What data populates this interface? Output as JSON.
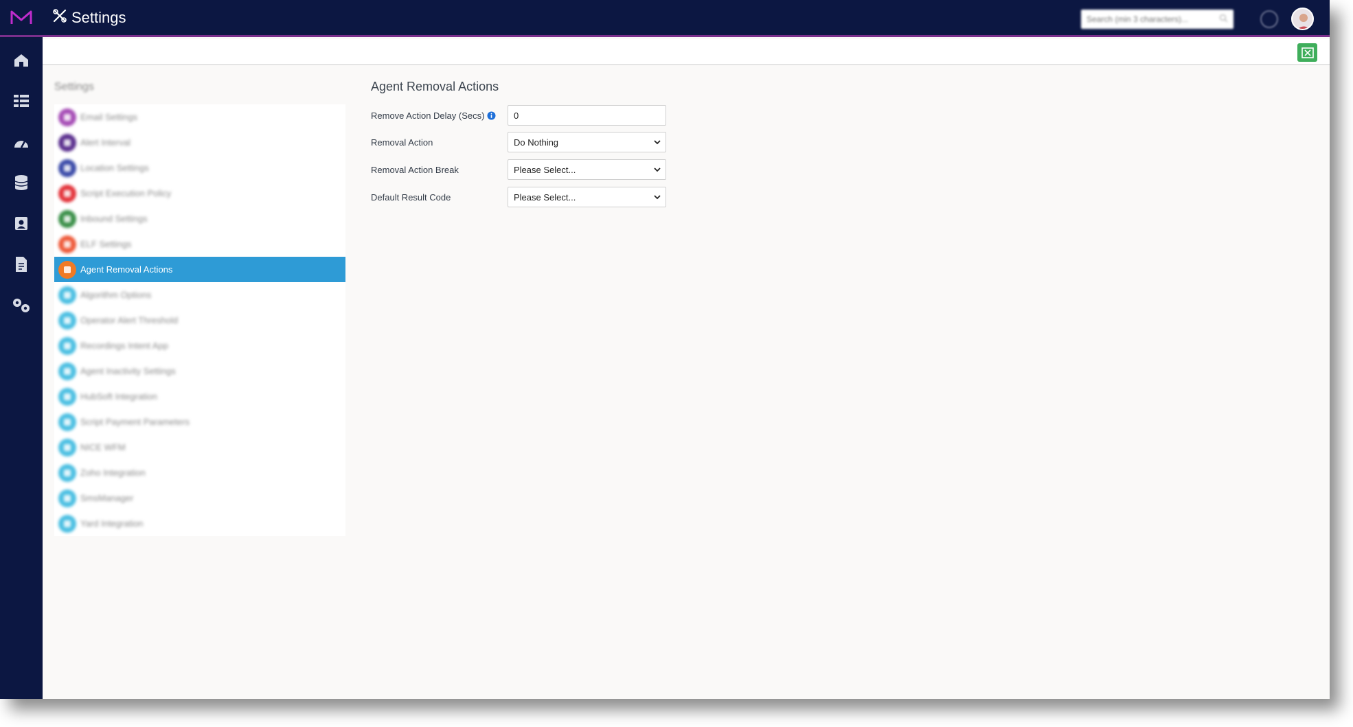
{
  "app": {
    "title": "Settings",
    "search_placeholder": "Search (min 3 characters)..."
  },
  "colors": {
    "topbar": "#0c1742",
    "accent": "#7b2f8c",
    "active_nav": "#2e9bd6",
    "export_button": "#3fae5b"
  },
  "rail": {
    "icons": [
      "home-icon",
      "grid-icon",
      "dashboard-icon",
      "database-icon",
      "contacts-icon",
      "report-icon",
      "tools-icon"
    ]
  },
  "settings": {
    "title": "Settings",
    "items": [
      {
        "label": "Email Settings",
        "color": "#a54bb5"
      },
      {
        "label": "Alert Interval",
        "color": "#5a2f8e"
      },
      {
        "label": "Location Settings",
        "color": "#3a4aa8"
      },
      {
        "label": "Script Execution Policy",
        "color": "#e3343b"
      },
      {
        "label": "Inbound Settings",
        "color": "#3a8f48"
      },
      {
        "label": "ELF Settings",
        "color": "#ee5a3a"
      },
      {
        "label": "Agent Removal Actions",
        "color": "#f07a24"
      },
      {
        "label": "Algorithm Options",
        "color": "#4bbfe2"
      },
      {
        "label": "Operator Alert Threshold",
        "color": "#4bbfe2"
      },
      {
        "label": "Recordings Intent App",
        "color": "#4bbfe2"
      },
      {
        "label": "Agent Inactivity Settings",
        "color": "#4bbfe2"
      },
      {
        "label": "HubSoft Integration",
        "color": "#4bbfe2"
      },
      {
        "label": "Script Payment Parameters",
        "color": "#4bbfe2"
      },
      {
        "label": "NICE WFM",
        "color": "#4bbfe2"
      },
      {
        "label": "Zoho Integration",
        "color": "#4bbfe2"
      },
      {
        "label": "SmsManager",
        "color": "#4bbfe2"
      },
      {
        "label": "Yard Integration",
        "color": "#4bbfe2"
      }
    ],
    "active_index": 6
  },
  "form": {
    "title": "Agent Removal Actions",
    "delay_label": "Remove Action Delay (Secs)",
    "delay_value": "0",
    "removal_action_label": "Removal Action",
    "removal_action_value": "Do Nothing",
    "removal_break_label": "Removal Action Break",
    "removal_break_value": "Please Select...",
    "result_code_label": "Default Result Code",
    "result_code_value": "Please Select..."
  }
}
